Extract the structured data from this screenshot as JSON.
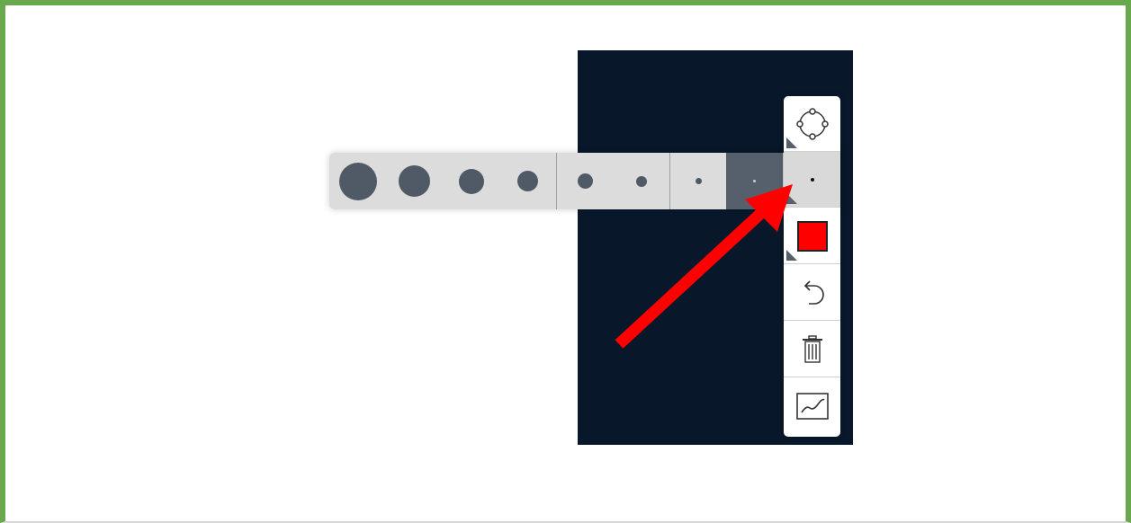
{
  "toolbar": {
    "tools": [
      {
        "name": "shape-tool",
        "icon": "circle-nodes-icon"
      },
      {
        "name": "brush-size-tool",
        "icon": "dot-icon"
      },
      {
        "name": "color-tool",
        "icon": "color-swatch-icon",
        "color": "#ff0000"
      },
      {
        "name": "undo-tool",
        "icon": "undo-icon"
      },
      {
        "name": "delete-tool",
        "icon": "trash-icon"
      },
      {
        "name": "chart-tool",
        "icon": "line-chart-icon"
      }
    ]
  },
  "brush_sizes": {
    "options": [
      "size-1",
      "size-2",
      "size-3",
      "size-4",
      "size-5",
      "size-6",
      "size-7",
      "size-8",
      "size-9"
    ],
    "selected_index": 7
  },
  "colors": {
    "frame_border": "#6aa84f",
    "canvas_bg": "#08182a",
    "active_color": "#ff0000",
    "annotation_arrow": "#ff0000"
  }
}
